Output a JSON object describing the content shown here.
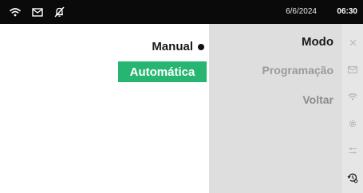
{
  "status": {
    "date": "6/6/2024",
    "time": "06:30",
    "icons": [
      "wifi-icon",
      "mail-icon",
      "bell-muted-icon"
    ]
  },
  "options": {
    "manual_label": "Manual",
    "auto_label": "Automática",
    "selected": "Automática"
  },
  "menu": {
    "items": [
      {
        "label": "Modo",
        "state": "active"
      },
      {
        "label": "Programação",
        "state": "inactive"
      },
      {
        "label": "Voltar",
        "state": "inactive"
      }
    ]
  },
  "sidebar": {
    "icons": [
      "close-icon",
      "mail-icon",
      "wifi-icon",
      "gear-icon",
      "sliders-icon",
      "clock-settings-icon"
    ]
  },
  "colors": {
    "statusbar_bg": "#0a0a0a",
    "highlight": "#27b572",
    "menu_bg": "#dedede",
    "iconbar_bg": "#e6e6e6"
  }
}
